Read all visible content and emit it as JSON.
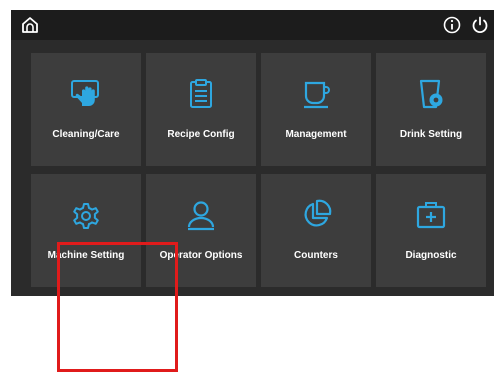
{
  "topbar": {
    "left_icon": "home-icon",
    "right_icons": [
      "info-icon",
      "power-icon"
    ],
    "icon_color": "#ffffff"
  },
  "accent_color": "#2ea7e0",
  "tiles": [
    {
      "label": "Cleaning/Care",
      "icon": "hand-cleaning-icon"
    },
    {
      "label": "Recipe Config",
      "icon": "clipboard-icon"
    },
    {
      "label": "Management",
      "icon": "cup-icon"
    },
    {
      "label": "Drink Setting",
      "icon": "cup-gear-icon"
    },
    {
      "label": "Machine Setting",
      "icon": "gear-icon"
    },
    {
      "label": "Operator Options",
      "icon": "user-icon"
    },
    {
      "label": "Counters",
      "icon": "pie-chart-icon"
    },
    {
      "label": "Diagnostic",
      "icon": "first-aid-icon"
    }
  ],
  "annotation": {
    "color": "#e01b1b",
    "shape": "highlight-rectangle"
  }
}
